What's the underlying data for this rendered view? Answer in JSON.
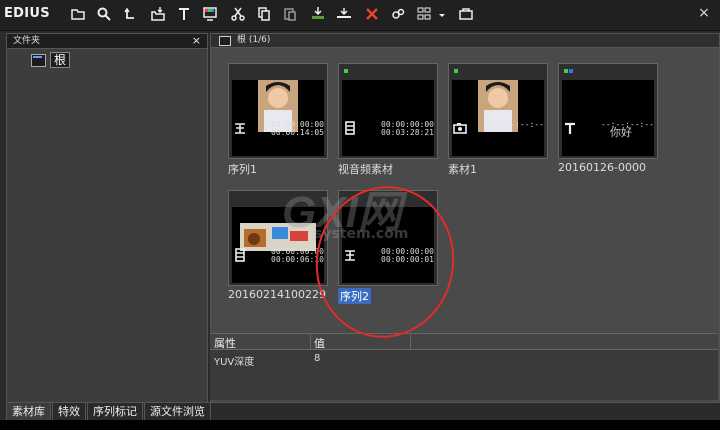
{
  "app": {
    "brand": "EDIUS"
  },
  "toolbar": {
    "buttons": [
      "new-folder-icon",
      "search-icon",
      "up-icon",
      "import-icon",
      "title-icon",
      "monitor-icon",
      "cut-icon",
      "copy-icon",
      "paste-icon",
      "add-to-timeline-icon",
      "insert-icon",
      "delete-icon",
      "properties-icon",
      "view-icon",
      "dropdown-icon",
      "batch-icon"
    ],
    "close": "×"
  },
  "left_panel": {
    "title": "文件夹",
    "close": "×",
    "tree_root": "根"
  },
  "right_panel": {
    "title": "根 (1/6)"
  },
  "clips": [
    {
      "name": "序列1",
      "in": "00:00:00:00",
      "out": "00:00:14:05",
      "type": "sequence-icon"
    },
    {
      "name": "视音频素材",
      "in": "00:00:00:00",
      "out": "00:03:28:21",
      "type": "clip-icon"
    },
    {
      "name": "素材1",
      "in": "--:--:--:--",
      "out": "",
      "type": "camera-icon"
    },
    {
      "name": "20160126-0000",
      "in": "--:--:--:--",
      "out": "",
      "type": "title-icon",
      "text": "你好"
    },
    {
      "name": "20160214100229",
      "in": "00:00:00:00",
      "out": "00:00:06:10",
      "type": "clip-icon"
    },
    {
      "name": "序列2",
      "in": "00:00:00:00",
      "out": "00:00:00:01",
      "type": "sequence-icon"
    }
  ],
  "properties": {
    "col1": "属性",
    "col2": "值",
    "row_name": "YUV深度",
    "row_value": "8"
  },
  "tabs": [
    "素材库",
    "特效",
    "序列标记",
    "源文件浏览"
  ],
  "watermark": {
    "main": "GXI网",
    "sub": "system.com"
  },
  "colors": {
    "accent": "#3b6cc1",
    "highlight": "#e32b2b",
    "status": "#3fcf3f"
  }
}
